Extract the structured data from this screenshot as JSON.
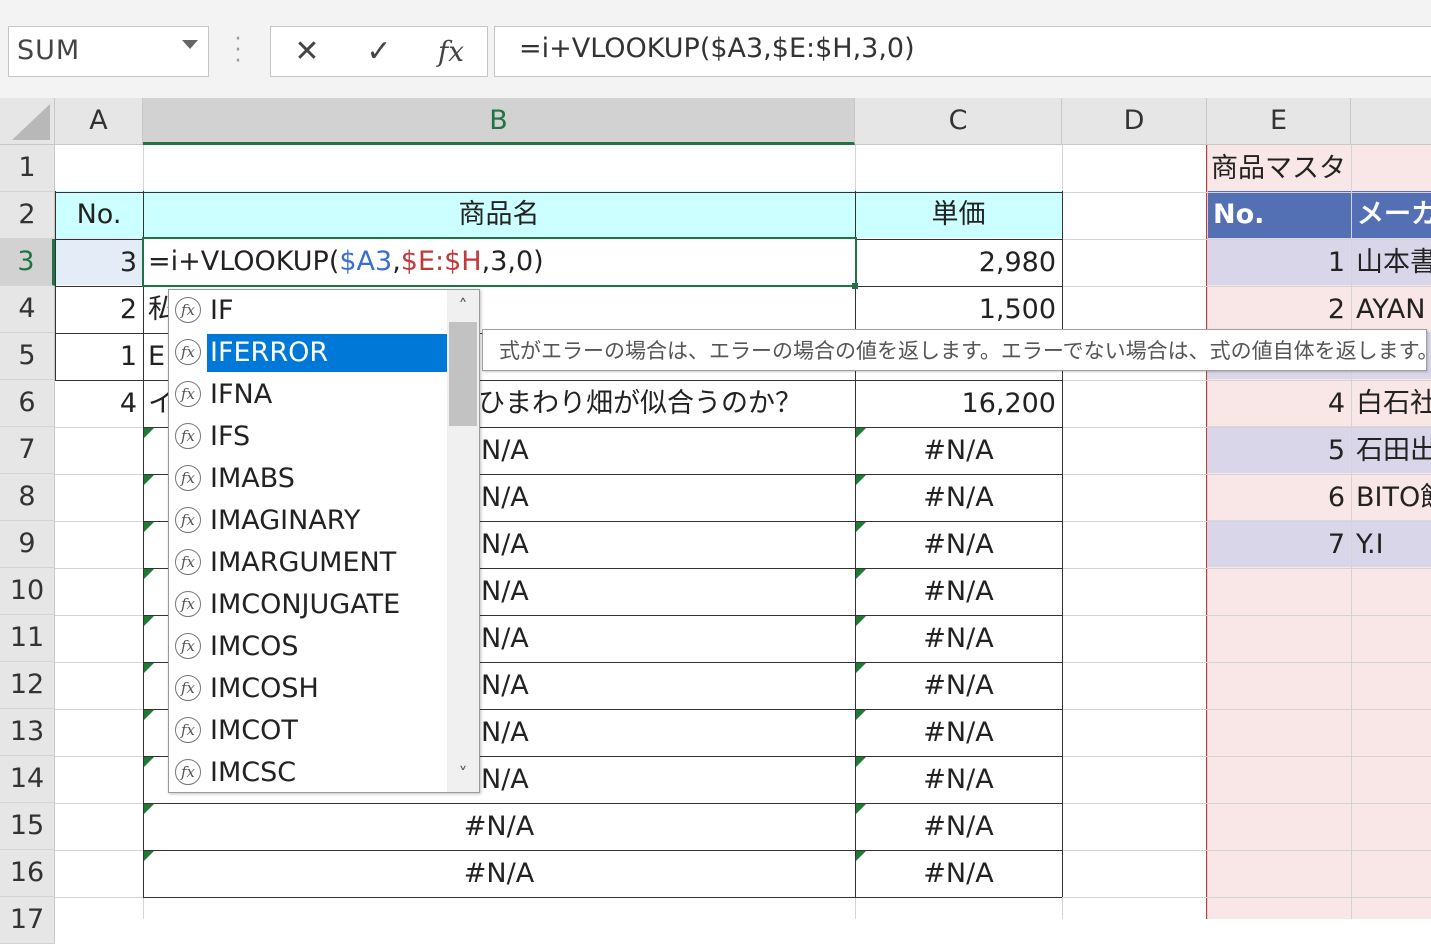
{
  "name_box": {
    "value": "SUM"
  },
  "formula_bar": {
    "cancel_icon": "✕",
    "enter_icon": "✓",
    "fx_label": "fx",
    "formula": "=i+VLOOKUP($A3,$E:$H,3,0)"
  },
  "columns": [
    "A",
    "B",
    "C",
    "D",
    "E"
  ],
  "rows": [
    "1",
    "2",
    "3",
    "4",
    "5",
    "6",
    "7",
    "8",
    "9",
    "10",
    "11",
    "12",
    "13",
    "14",
    "15",
    "16",
    "17"
  ],
  "table": {
    "header_no": "No.",
    "header_name": "商品名",
    "header_price": "単価",
    "rows": [
      {
        "no": "3",
        "name_visible": "",
        "price": "2,980"
      },
      {
        "no": "2",
        "name_visible": "私",
        "price": "1,500"
      },
      {
        "no": "1",
        "name_visible": "E",
        "price": ""
      },
      {
        "no": "4",
        "name_visible": "イ",
        "name_tail": "ひまわり畑が似合うのか？",
        "price": "16,200"
      }
    ],
    "na_text": "#N/A",
    "na_partial": "N/A"
  },
  "active_cell": {
    "eq": "=i+VLOOKUP(",
    "ref1": "$A3",
    "comma1": ",",
    "ref2": "$E:$H",
    "tail": ",3,0)"
  },
  "master": {
    "title": "商品マスタ",
    "header_no": "No.",
    "header_maker": "メーカ",
    "rows": [
      {
        "no": "1",
        "maker": "山本書"
      },
      {
        "no": "2",
        "maker": "AYAN"
      },
      {
        "no": "",
        "maker": ""
      },
      {
        "no": "4",
        "maker": "白石社"
      },
      {
        "no": "5",
        "maker": "石田出"
      },
      {
        "no": "6",
        "maker": "BITO館"
      },
      {
        "no": "7",
        "maker": "Y.I"
      }
    ]
  },
  "autocomplete": {
    "items": [
      "IF",
      "IFERROR",
      "IFNA",
      "IFS",
      "IMABS",
      "IMAGINARY",
      "IMARGUMENT",
      "IMCONJUGATE",
      "IMCOS",
      "IMCOSH",
      "IMCOT",
      "IMCSC"
    ],
    "selected_index": 1,
    "fx_glyph": "fx",
    "scroll_up": "˄",
    "scroll_down": "˅"
  },
  "tooltip": {
    "text": "式がエラーの場合は、エラーの場合の値を返します。エラーでない場合は、式の値自体を返します。"
  }
}
